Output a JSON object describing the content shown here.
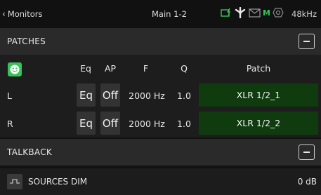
{
  "topbar": {
    "back_label": "Monitors",
    "title": "Main 1-2",
    "status_m": "M",
    "sample_rate": "48kHz",
    "icons": [
      "card-power-icon",
      "fan-icon",
      "mail-icon",
      "m-indicator",
      "hex-icon"
    ],
    "colors": {
      "ok": "#37c35a",
      "warn": "#c8c8c8"
    }
  },
  "patches": {
    "title": "PATCHES",
    "headers": {
      "eq": "Eq",
      "ap": "AP",
      "f": "F",
      "q": "Q",
      "patch": "Patch"
    },
    "rows": [
      {
        "label": "L",
        "eq": "Eq",
        "ap": "Off",
        "f": "2000 Hz",
        "q": "1.0",
        "patch": "XLR 1/2_1"
      },
      {
        "label": "R",
        "eq": "Eq",
        "ap": "Off",
        "f": "2000 Hz",
        "q": "1.0",
        "patch": "XLR 1/2_2"
      }
    ],
    "patch_color": "#0f3b0f",
    "accent": "#37c35a"
  },
  "talkback": {
    "title": "TALKBACK"
  },
  "sources_dim": {
    "label": "SOURCES DIM",
    "value": "0 dB"
  }
}
